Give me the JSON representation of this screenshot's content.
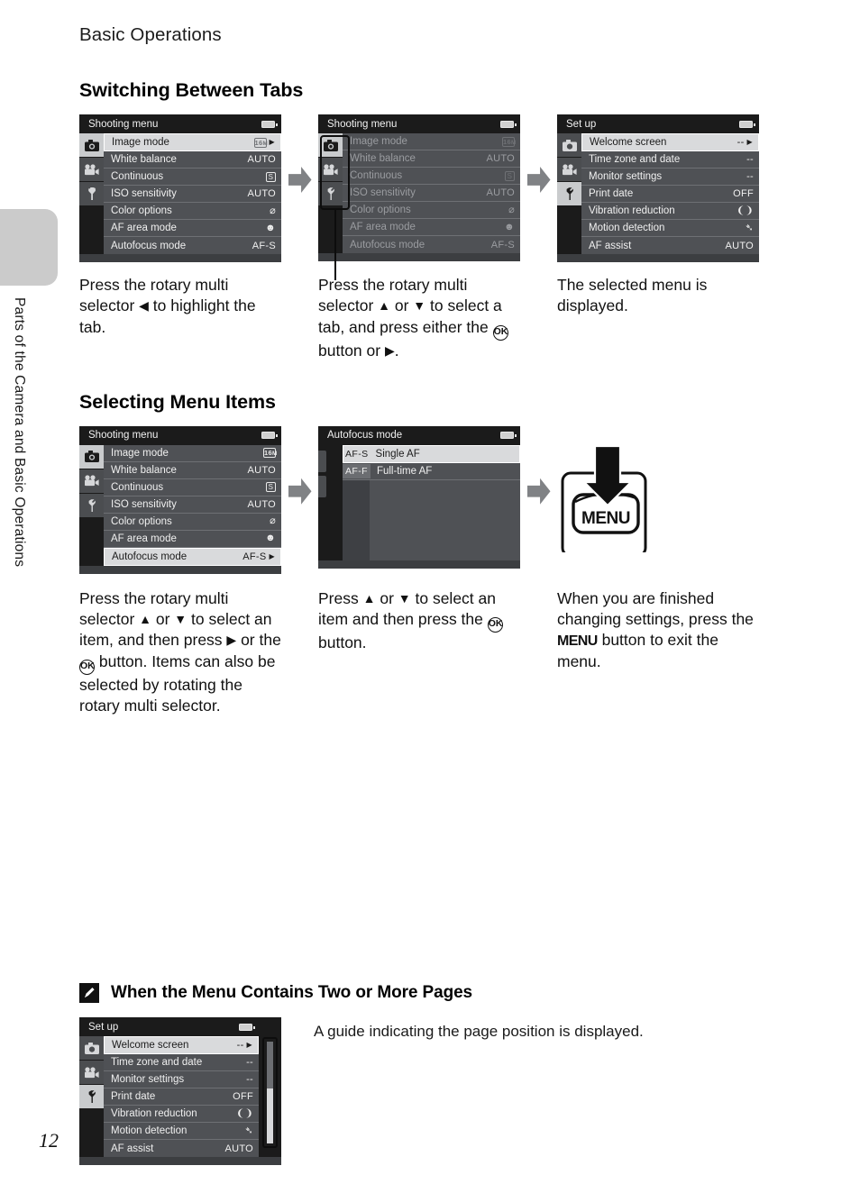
{
  "page": {
    "running_head": "Basic Operations",
    "page_number": "12",
    "side_tab_label": "Parts of the Camera and Basic Operations"
  },
  "section1": {
    "title": "Switching Between Tabs",
    "panels": [
      {
        "screen_title": "Shooting menu",
        "battery_icon": "battery-icon",
        "tabs": [
          {
            "icon": "camera-icon",
            "active": true
          },
          {
            "icon": "movie-camera-icon",
            "active": false
          },
          {
            "icon": "wrench-icon",
            "active": false
          }
        ],
        "rows": [
          {
            "label": "Image mode",
            "value": "16M",
            "value_icon": "image-size-16m-icon",
            "selected": true,
            "caret": true
          },
          {
            "label": "White balance",
            "value": "AUTO"
          },
          {
            "label": "Continuous",
            "value": "S",
            "value_icon": "single-shot-icon"
          },
          {
            "label": "ISO sensitivity",
            "value": "AUTO"
          },
          {
            "label": "Color options",
            "value": "",
            "value_icon": "color-options-icon"
          },
          {
            "label": "AF area mode",
            "value": "",
            "value_icon": "face-priority-icon"
          },
          {
            "label": "Autofocus mode",
            "value": "AF-S"
          }
        ]
      },
      {
        "screen_title": "Shooting menu",
        "battery_icon": "battery-icon",
        "tabs_highlighted": true,
        "tabs": [
          {
            "icon": "camera-icon",
            "active": true
          },
          {
            "icon": "movie-camera-icon",
            "active": false
          },
          {
            "icon": "wrench-icon",
            "active": false
          }
        ],
        "rows": [
          {
            "label": "Image mode",
            "value": "16M",
            "value_icon": "image-size-16m-icon",
            "dim": true
          },
          {
            "label": "White balance",
            "value": "AUTO",
            "dim": true
          },
          {
            "label": "Continuous",
            "value": "S",
            "value_icon": "single-shot-icon",
            "dim": true
          },
          {
            "label": "ISO sensitivity",
            "value": "AUTO",
            "dim": true
          },
          {
            "label": "Color options",
            "value": "",
            "value_icon": "color-options-icon",
            "dim": true
          },
          {
            "label": "AF area mode",
            "value": "",
            "value_icon": "face-priority-icon",
            "dim": true
          },
          {
            "label": "Autofocus mode",
            "value": "AF-S",
            "dim": true
          }
        ]
      },
      {
        "screen_title": "Set up",
        "battery_icon": "battery-icon",
        "tabs": [
          {
            "icon": "camera-icon",
            "active": false
          },
          {
            "icon": "movie-camera-icon",
            "active": false
          },
          {
            "icon": "wrench-icon",
            "active": true
          }
        ],
        "rows": [
          {
            "label": "Welcome screen",
            "value": "--",
            "selected": true,
            "caret": true
          },
          {
            "label": "Time zone and date",
            "value": "--"
          },
          {
            "label": "Monitor settings",
            "value": "--"
          },
          {
            "label": "Print date",
            "value": "OFF"
          },
          {
            "label": "Vibration reduction",
            "value": "",
            "value_icon": "vibration-reduction-icon"
          },
          {
            "label": "Motion detection",
            "value": "",
            "value_icon": "motion-detection-icon"
          },
          {
            "label": "AF assist",
            "value": "AUTO"
          }
        ]
      }
    ],
    "captions": [
      {
        "parts": [
          {
            "t": "text",
            "v": "Press the rotary multi selector "
          },
          {
            "t": "glyph",
            "v": "◀"
          },
          {
            "t": "text",
            "v": " to highlight the tab."
          }
        ]
      },
      {
        "parts": [
          {
            "t": "text",
            "v": "Press the rotary multi selector "
          },
          {
            "t": "glyph",
            "v": "▲"
          },
          {
            "t": "text",
            "v": " or "
          },
          {
            "t": "glyph",
            "v": "▼"
          },
          {
            "t": "text",
            "v": " to select a tab, and press either the "
          },
          {
            "t": "ok",
            "v": "OK"
          },
          {
            "t": "text",
            "v": " button or "
          },
          {
            "t": "glyph",
            "v": "▶"
          },
          {
            "t": "text",
            "v": "."
          }
        ]
      },
      {
        "parts": [
          {
            "t": "text",
            "v": "The selected menu is displayed."
          }
        ]
      }
    ]
  },
  "section2": {
    "title": "Selecting Menu Items",
    "panels": [
      {
        "screen_title": "Shooting menu",
        "battery_icon": "battery-icon",
        "tabs": [
          {
            "icon": "camera-icon",
            "active": true
          },
          {
            "icon": "movie-camera-icon",
            "active": false
          },
          {
            "icon": "wrench-icon",
            "active": false
          }
        ],
        "rows": [
          {
            "label": "Image mode",
            "value": "16M",
            "value_icon": "image-size-16m-icon"
          },
          {
            "label": "White balance",
            "value": "AUTO"
          },
          {
            "label": "Continuous",
            "value": "S",
            "value_icon": "single-shot-icon"
          },
          {
            "label": "ISO sensitivity",
            "value": "AUTO"
          },
          {
            "label": "Color options",
            "value": "",
            "value_icon": "color-options-icon"
          },
          {
            "label": "AF area mode",
            "value": "",
            "value_icon": "face-priority-icon"
          },
          {
            "label": "Autofocus mode",
            "value": "AF-S",
            "selected": true,
            "caret": true
          }
        ]
      },
      {
        "screen_title": "Autofocus mode",
        "battery_icon": "battery-icon",
        "options": [
          {
            "badge": "AF-S",
            "label": "Single AF",
            "selected": true
          },
          {
            "badge": "AF-F",
            "label": "Full-time AF",
            "selected": false
          }
        ]
      },
      {
        "illustration": "menu-button-press-illustration",
        "button_label": "MENU",
        "arrow": "down-arrow-icon"
      }
    ],
    "captions": [
      {
        "parts": [
          {
            "t": "text",
            "v": "Press the rotary multi selector "
          },
          {
            "t": "glyph",
            "v": "▲"
          },
          {
            "t": "text",
            "v": " or "
          },
          {
            "t": "glyph",
            "v": "▼"
          },
          {
            "t": "text",
            "v": " to select an item, and then press "
          },
          {
            "t": "glyph",
            "v": "▶"
          },
          {
            "t": "text",
            "v": " or the "
          },
          {
            "t": "ok",
            "v": "OK"
          },
          {
            "t": "text",
            "v": " button."
          }
        ],
        "extra": "Items can also be selected by rotating the rotary multi selector."
      },
      {
        "parts": [
          {
            "t": "text",
            "v": "Press "
          },
          {
            "t": "glyph",
            "v": "▲"
          },
          {
            "t": "text",
            "v": " or "
          },
          {
            "t": "glyph",
            "v": "▼"
          },
          {
            "t": "text",
            "v": " to select an item and then press the "
          },
          {
            "t": "ok",
            "v": "OK"
          },
          {
            "t": "text",
            "v": " button."
          }
        ]
      },
      {
        "parts": [
          {
            "t": "text",
            "v": "When you are finished changing settings, press the "
          },
          {
            "t": "menu",
            "v": "MENU"
          },
          {
            "t": "text",
            "v": " button to exit the menu."
          }
        ]
      }
    ]
  },
  "note": {
    "icon": "pencil-note-icon",
    "title": "When the Menu Contains Two or More Pages",
    "text": "A guide indicating the page position is displayed.",
    "screen": {
      "screen_title": "Set up",
      "battery_icon": "battery-icon",
      "tabs": [
        {
          "icon": "camera-icon",
          "active": false
        },
        {
          "icon": "movie-camera-icon",
          "active": false
        },
        {
          "icon": "wrench-icon",
          "active": true
        }
      ],
      "rows": [
        {
          "label": "Welcome screen",
          "value": "--",
          "selected": true,
          "caret": true
        },
        {
          "label": "Time zone and date",
          "value": "--"
        },
        {
          "label": "Monitor settings",
          "value": "--"
        },
        {
          "label": "Print date",
          "value": "OFF"
        },
        {
          "label": "Vibration reduction",
          "value": "",
          "value_icon": "vibration-reduction-icon"
        },
        {
          "label": "Motion detection",
          "value": "",
          "value_icon": "motion-detection-icon"
        },
        {
          "label": "AF assist",
          "value": "AUTO"
        }
      ],
      "page_guide": "page-position-scrollbar"
    }
  },
  "colors": {
    "lcd_background": "#1b1b1b",
    "lcd_row": "#4f5155",
    "lcd_selected": "#d9dadc",
    "tab_inactive": "#4b4d50",
    "tab_active": "#c9cbcd",
    "arrow_gray": "#808285",
    "edge_tab_gray": "#cbcbcb"
  }
}
